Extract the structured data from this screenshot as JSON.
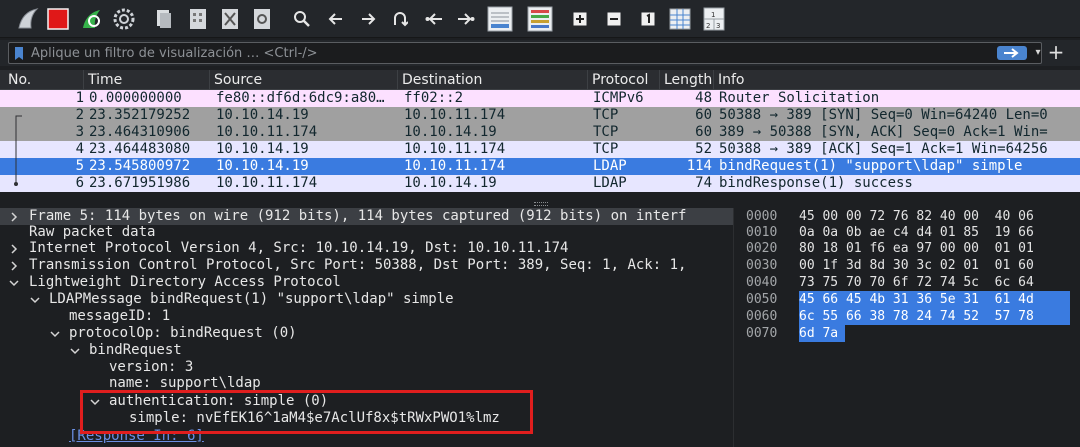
{
  "toolbar": {
    "icons": [
      "shark-fin-icon",
      "stop-icon",
      "restart-capture-icon",
      "capture-options-icon",
      "open-file-icon",
      "save-file-icon",
      "close-file-icon",
      "reload-icon",
      "find-icon",
      "go-back-icon",
      "go-forward-icon",
      "go-to-packet-icon",
      "first-packet-icon",
      "last-packet-icon",
      "auto-scroll-icon",
      "colorize-icon",
      "zoom-in-icon",
      "zoom-out-icon",
      "normal-size-icon",
      "resize-columns-icon",
      "expand-subtrees-icon"
    ]
  },
  "filter": {
    "placeholder": "Aplique un filtro de visualización … <Ctrl-/>",
    "add_label": "+"
  },
  "packet_list": {
    "columns": [
      "No.",
      "Time",
      "Source",
      "Destination",
      "Protocol",
      "Length",
      "Info"
    ],
    "rows": [
      {
        "no": "1",
        "time": "0.000000000",
        "source": "fe80::df6d:6dc9:a80…",
        "destination": "ff02::2",
        "protocol": "ICMPv6",
        "length": "48",
        "info": "Router Solicitation"
      },
      {
        "no": "2",
        "time": "23.352179252",
        "source": "10.10.14.19",
        "destination": "10.10.11.174",
        "protocol": "TCP",
        "length": "60",
        "info": "50388 → 389 [SYN] Seq=0 Win=64240 Len=0"
      },
      {
        "no": "3",
        "time": "23.464310906",
        "source": "10.10.11.174",
        "destination": "10.10.14.19",
        "protocol": "TCP",
        "length": "60",
        "info": "389 → 50388 [SYN, ACK] Seq=0 Ack=1 Win="
      },
      {
        "no": "4",
        "time": "23.464483080",
        "source": "10.10.14.19",
        "destination": "10.10.11.174",
        "protocol": "TCP",
        "length": "52",
        "info": "50388 → 389 [ACK] Seq=1 Ack=1 Win=64256"
      },
      {
        "no": "5",
        "time": "23.545800972",
        "source": "10.10.14.19",
        "destination": "10.10.11.174",
        "protocol": "LDAP",
        "length": "114",
        "info": "bindRequest(1) \"support\\ldap\" simple"
      },
      {
        "no": "6",
        "time": "23.671951986",
        "source": "10.10.11.174",
        "destination": "10.10.14.19",
        "protocol": "LDAP",
        "length": "74",
        "info": "bindResponse(1) success"
      }
    ]
  },
  "details": {
    "rows": [
      {
        "text": "Frame 5: 114 bytes on wire (912 bits), 114 bytes captured (912 bits) on interf"
      },
      {
        "text": "Raw packet data"
      },
      {
        "text": "Internet Protocol Version 4, Src: 10.10.14.19, Dst: 10.10.11.174"
      },
      {
        "text": "Transmission Control Protocol, Src Port: 50388, Dst Port: 389, Seq: 1, Ack: 1,"
      },
      {
        "text": "Lightweight Directory Access Protocol"
      },
      {
        "text": "LDAPMessage bindRequest(1) \"support\\ldap\" simple"
      },
      {
        "text": "messageID: 1"
      },
      {
        "text": "protocolOp: bindRequest (0)"
      },
      {
        "text": "bindRequest"
      },
      {
        "text": "version: 3"
      },
      {
        "text": "name: support\\ldap"
      },
      {
        "text": "authentication: simple (0)"
      },
      {
        "text": "simple: nvEfEK16^1aM4$e7AclUf8x$tRWxPWO1%lmz"
      },
      {
        "text": "[Response In: 6]"
      }
    ]
  },
  "bytes": {
    "rows": [
      {
        "offset": "0000",
        "hex": "45 00 00 72 76 82 40 00  40 06"
      },
      {
        "offset": "0010",
        "hex": "0a 0a 0b ae c4 d4 01 85  19 66"
      },
      {
        "offset": "0020",
        "hex": "80 18 01 f6 ea 97 00 00  01 01"
      },
      {
        "offset": "0030",
        "hex": "00 1f 3d 8d 30 3c 02 01  01 60"
      },
      {
        "offset": "0040",
        "hex": "73 75 70 70 6f 72 74 5c  6c 64"
      },
      {
        "offset": "0050",
        "hex": "45 66 45 4b 31 36 5e 31  61 4d"
      },
      {
        "offset": "0060",
        "hex": "6c 55 66 38 78 24 74 52  57 78"
      },
      {
        "offset": "0070",
        "hex": "6d 7a"
      }
    ]
  },
  "colors": {
    "selected": "#3a7be0",
    "icmp_row": "#fce0ff",
    "tcp_row": "#a0a0a0",
    "tcp_light_row": "#e7e6ff",
    "highlight_border": "#e01e1e"
  }
}
